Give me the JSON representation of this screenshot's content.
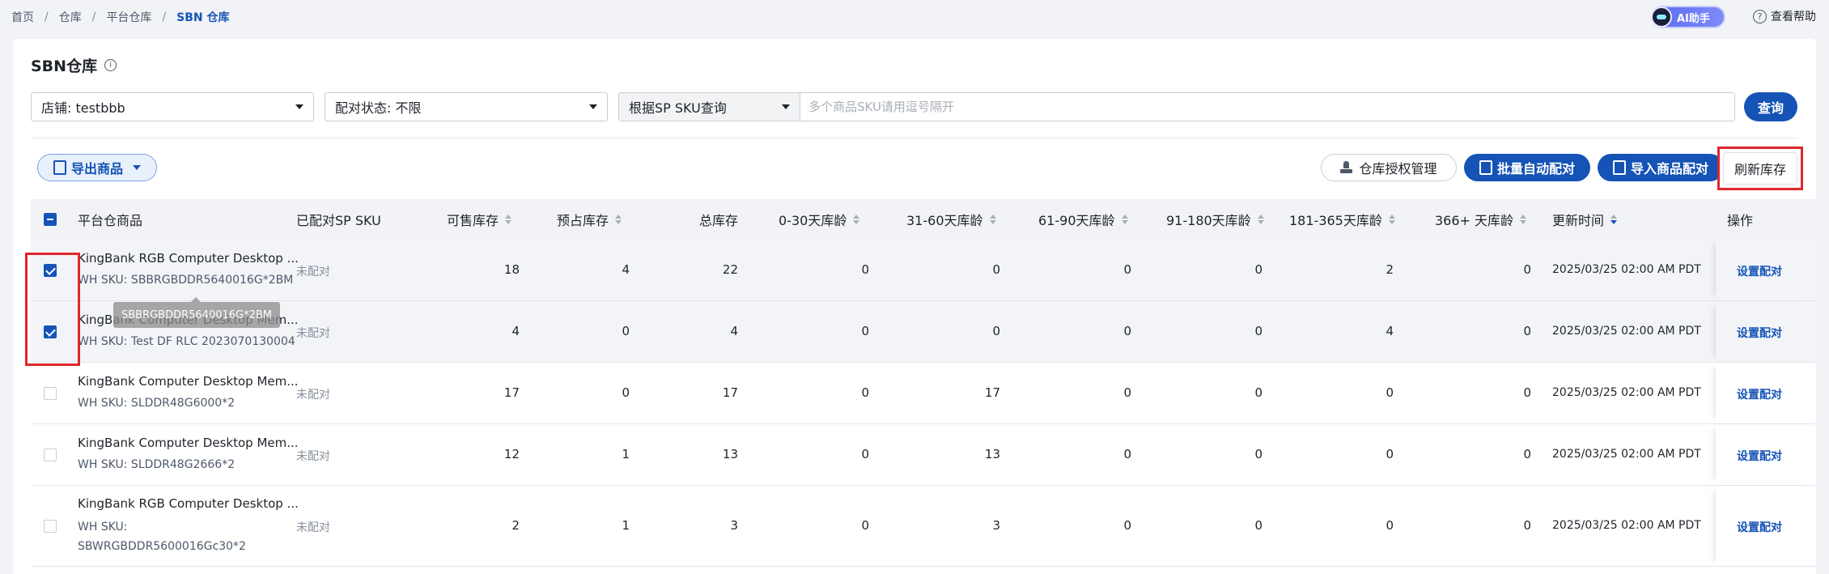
{
  "breadcrumb": [
    "首页",
    "仓库",
    "平台仓库",
    "SBN 仓库"
  ],
  "ai_label": "AI助手",
  "help_label": "查看帮助",
  "title": "SBN仓库",
  "filters": {
    "shop": "店铺: testbbb",
    "match_status": "配对状态: 不限",
    "search_type": "根据SP SKU查询",
    "search_placeholder": "多个商品SKU请用逗号隔开",
    "query_label": "查询"
  },
  "toolbar": {
    "export_label": "导出商品",
    "auth_label": "仓库授权管理",
    "batch_label": "批量自动配对",
    "import_label": "导入商品配对",
    "refresh_label": "刷新库存"
  },
  "columns": [
    "平台仓商品",
    "已配对SP SKU",
    "可售库存",
    "预占库存",
    "总库存",
    "0-30天库龄",
    "31-60天库龄",
    "61-90天库龄",
    "91-180天库龄",
    "181-365天库龄",
    "366+ 天库龄",
    "更新时间",
    "操作"
  ],
  "tooltip": "SBBRGBDDR5640016G*2BM",
  "rows": [
    {
      "checked": true,
      "name": "KingBank RGB Computer Desktop ...",
      "wh_sku": "WH SKU: SBBRGBDDR5640016G*2BM",
      "wh_sku2": "",
      "matched": "未配对",
      "sellable": "18",
      "reserved": "4",
      "total": "22",
      "a0_30": "0",
      "a31_60": "0",
      "a61_90": "0",
      "a91_180": "0",
      "a181_365": "2",
      "a366": "0",
      "updated": "2025/03/25 02:00 AM PDT",
      "action": "设置配对"
    },
    {
      "checked": true,
      "name": "KingBank Computer Desktop Mem...",
      "wh_sku": "WH SKU: Test DF RLC 2023070130004",
      "wh_sku2": "",
      "matched": "未配对",
      "sellable": "4",
      "reserved": "0",
      "total": "4",
      "a0_30": "0",
      "a31_60": "0",
      "a61_90": "0",
      "a91_180": "0",
      "a181_365": "4",
      "a366": "0",
      "updated": "2025/03/25 02:00 AM PDT",
      "action": "设置配对"
    },
    {
      "checked": false,
      "name": "KingBank Computer Desktop Mem...",
      "wh_sku": "WH SKU: SLDDR48G6000*2",
      "wh_sku2": "",
      "matched": "未配对",
      "sellable": "17",
      "reserved": "0",
      "total": "17",
      "a0_30": "0",
      "a31_60": "17",
      "a61_90": "0",
      "a91_180": "0",
      "a181_365": "0",
      "a366": "0",
      "updated": "2025/03/25 02:00 AM PDT",
      "action": "设置配对"
    },
    {
      "checked": false,
      "name": "KingBank Computer Desktop Mem...",
      "wh_sku": "WH SKU: SLDDR48G2666*2",
      "wh_sku2": "",
      "matched": "未配对",
      "sellable": "12",
      "reserved": "1",
      "total": "13",
      "a0_30": "0",
      "a31_60": "13",
      "a61_90": "0",
      "a91_180": "0",
      "a181_365": "0",
      "a366": "0",
      "updated": "2025/03/25 02:00 AM PDT",
      "action": "设置配对"
    },
    {
      "checked": false,
      "name": "KingBank RGB Computer Desktop ...",
      "wh_sku": "WH SKU:",
      "wh_sku2": "SBWRGBDDR5600016Gc30*2",
      "matched": "未配对",
      "sellable": "2",
      "reserved": "1",
      "total": "3",
      "a0_30": "0",
      "a31_60": "3",
      "a61_90": "0",
      "a91_180": "0",
      "a181_365": "0",
      "a366": "0",
      "updated": "2025/03/25 02:00 AM PDT",
      "action": "设置配对"
    }
  ]
}
